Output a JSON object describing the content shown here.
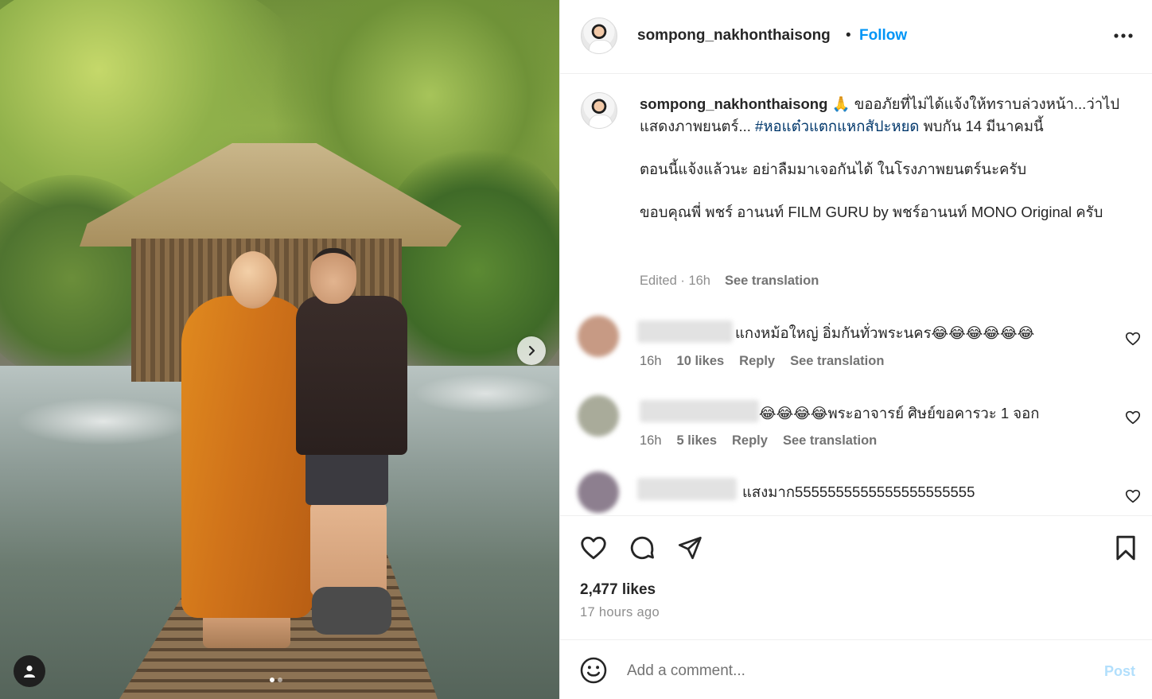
{
  "post": {
    "username": "sompong_nakhonthaisong",
    "separator": "•",
    "follow_label": "Follow",
    "more_icon": "more-horizontal-icon",
    "carousel": {
      "next_icon": "chevron-right-icon",
      "user_tag_icon": "user-icon",
      "slide_count": 2,
      "active_slide": 1
    }
  },
  "caption": {
    "username": "sompong_nakhonthaisong",
    "line1_pre": " 🙏 ขออภัยที่ไม่ได้แจ้งให้ทราบล่วงหน้า...ว่าไปแสดงภาพยนตร์... ",
    "hashtag": "#หอแต๋วแตกแหกสัปะหยด",
    "line1_post": " พบกัน 14 มีนาคมนี้",
    "paragraph2": "ตอนนี้แจ้งแล้วนะ อย่าลืมมาเจอกันได้ ในโรงภาพยนตร์นะครับ",
    "paragraph3": "ขอบคุณพี่ พชร์ อานนท์ FILM GURU by พชร์อานนท์ MONO Original ครับ",
    "edited": "Edited · 16h",
    "see_translation": "See translation"
  },
  "comments": [
    {
      "text": "แกงหม้อใหญ่ อิ่มกันทั่วพระนคร😂😂😂😂😂😂",
      "time": "16h",
      "likes": "10 likes",
      "reply": "Reply",
      "see_translation": "See translation",
      "avatar_color": "#c79a84"
    },
    {
      "text": "😂😂😂😂พระอาจารย์ ศิษย์ขอคารวะ 1 จอก",
      "time": "16h",
      "likes": "5 likes",
      "reply": "Reply",
      "see_translation": "See translation",
      "avatar_color": "#a9ab9a"
    },
    {
      "text": "แสงมาก5555555555555555555555",
      "avatar_color": "#8d7f8f"
    }
  ],
  "actions": {
    "like_icon": "heart-icon",
    "comment_icon": "comment-icon",
    "share_icon": "send-icon",
    "save_icon": "bookmark-icon",
    "likes": "2,477 likes",
    "time_ago": "17 hours ago"
  },
  "comment_box": {
    "emoji_icon": "emoji-icon",
    "placeholder": "Add a comment...",
    "post_label": "Post"
  },
  "colors": {
    "accent": "#0095f6",
    "hashtag": "#00376b",
    "muted": "#737373",
    "post_disabled": "#b2dffc"
  }
}
